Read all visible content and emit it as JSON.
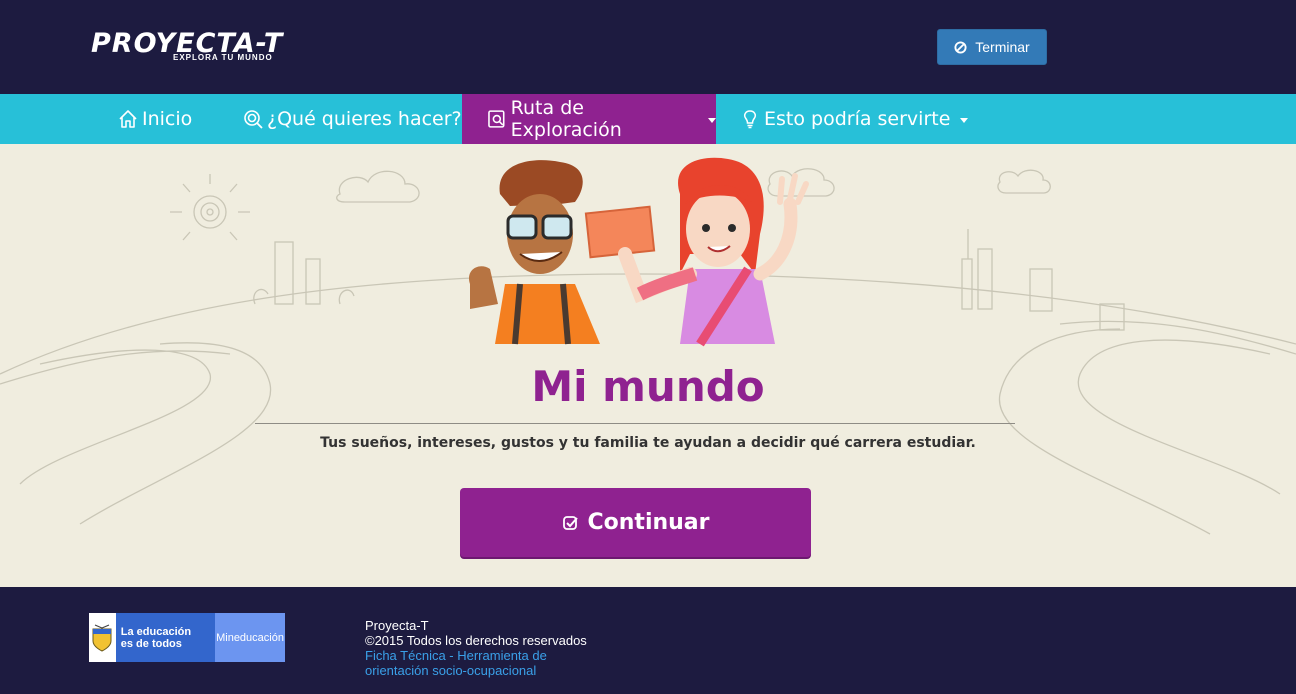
{
  "header": {
    "logo_main": "PROYECTA-T",
    "logo_sub": "EXPLORA TU MUNDO",
    "terminar_label": "Terminar"
  },
  "nav": {
    "items": [
      {
        "label": "Inicio",
        "icon": "home-icon"
      },
      {
        "label": "¿Qué quieres hacer?",
        "icon": "target-icon"
      },
      {
        "label": "Ruta de Exploración",
        "icon": "search-icon",
        "active": true,
        "dropdown": true
      },
      {
        "label": "Esto podría servirte",
        "icon": "lightbulb-icon",
        "dropdown": true
      }
    ]
  },
  "hero": {
    "title": "Mi mundo",
    "subtitle": "Tus sueños, intereses, gustos y tu familia te ayudan a decidir qué carrera estudiar.",
    "button_label": "Continuar"
  },
  "footer": {
    "gov_line1": "La educación",
    "gov_line2": "es de todos",
    "gov_right": "Mineducación",
    "brand": "Proyecta-T",
    "copyright": "©2015 Todos los derechos reservados",
    "link_line1": "Ficha Técnica - Herramienta de",
    "link_line2": "orientación socio-ocupacional"
  },
  "colors": {
    "header_bg": "#1d1b40",
    "nav_bg": "#27c0d8",
    "accent_purple": "#8f2290",
    "hero_bg": "#f0eddf",
    "button_blue": "#337ab7"
  }
}
